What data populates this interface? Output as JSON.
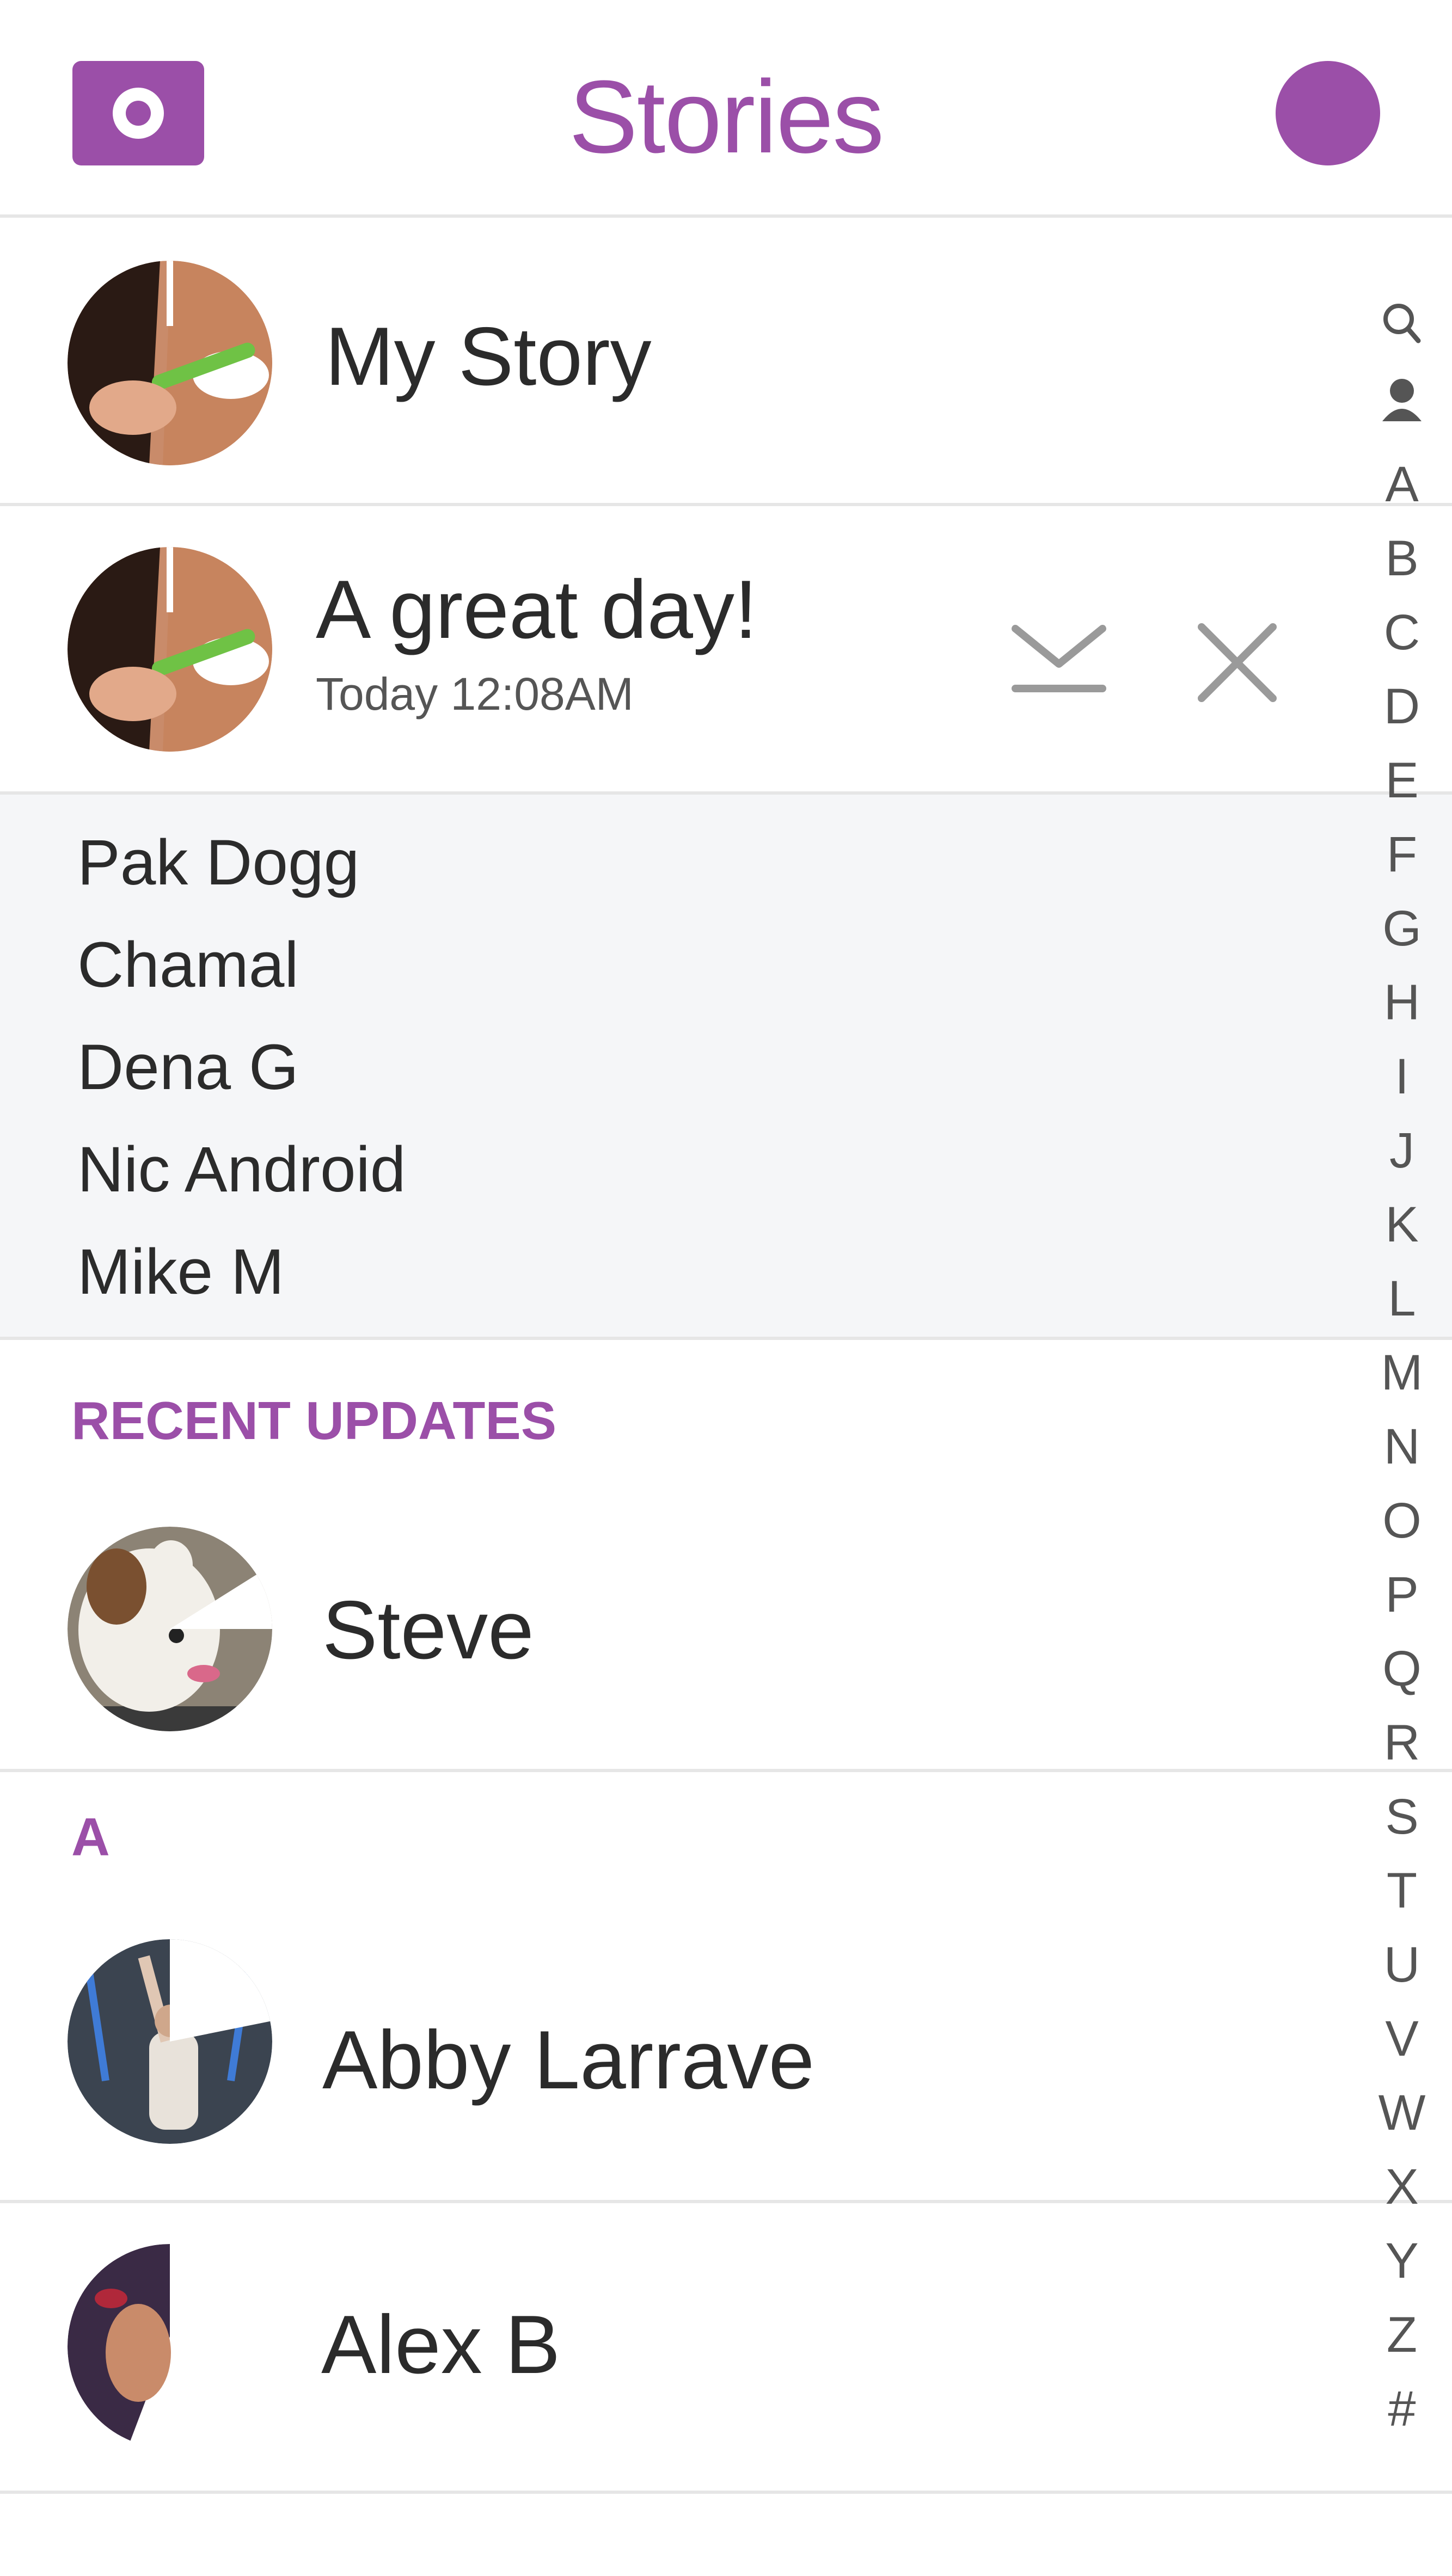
{
  "header": {
    "title": "Stories",
    "accent_color": "#9b4fa8",
    "left_icon": "camera-icon",
    "right_icon": "profile-icon"
  },
  "my_story": {
    "label": "My Story",
    "avatar_icon": "story-thumbnail-toothbrush"
  },
  "story": {
    "title": "A great day!",
    "timestamp": "Today 12:08AM",
    "avatar_icon": "story-thumbnail-toothbrush",
    "save_icon": "download-icon",
    "delete_icon": "close-icon",
    "viewers": [
      "Pak Dogg",
      "Chamal",
      "Dena G",
      "Nic Android",
      "Mike M"
    ]
  },
  "recent_updates": {
    "heading": "RECENT UPDATES",
    "items": [
      {
        "name": "Steve",
        "avatar_icon": "dog-thumbnail"
      }
    ]
  },
  "section_a": {
    "heading": "A",
    "items": [
      {
        "name": "Abby Larrave",
        "avatar_icon": "concert-thumbnail"
      },
      {
        "name": "Alex B",
        "avatar_icon": "portrait-thumbnail"
      }
    ]
  },
  "index_bar": {
    "items": [
      "search",
      "person",
      "A",
      "B",
      "C",
      "D",
      "E",
      "F",
      "G",
      "H",
      "I",
      "J",
      "K",
      "L",
      "M",
      "N",
      "O",
      "P",
      "Q",
      "R",
      "S",
      "T",
      "U",
      "V",
      "W",
      "X",
      "Y",
      "Z",
      "#"
    ]
  }
}
